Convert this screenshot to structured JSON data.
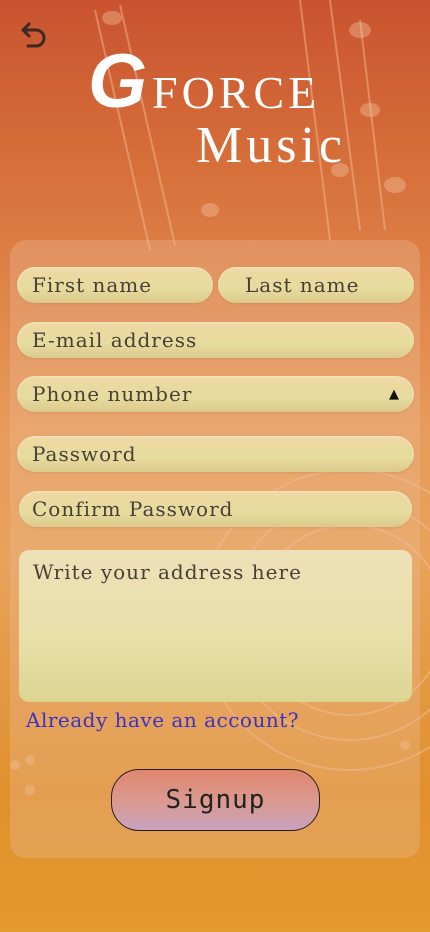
{
  "header": {
    "back_icon": "undo-arrow-icon",
    "logo_letter": "G",
    "logo_force": "FORCE",
    "logo_music": "Music"
  },
  "form": {
    "first_name_placeholder": "First name",
    "last_name_placeholder": "Last name",
    "email_placeholder": "E-mail address",
    "phone_placeholder": "Phone number",
    "phone_dropdown_icon": "caret-up-icon",
    "password_placeholder": "Password",
    "confirm_password_placeholder": "Confirm Password",
    "address_placeholder": "Write your address here",
    "login_link": "Already have an account?",
    "signup_label": "Signup"
  },
  "colors": {
    "bg_top": "#c9532f",
    "bg_bottom": "#e39a2e",
    "field_fill": "#e6dc9e",
    "link": "#3b33c8",
    "button_top": "#e0876e",
    "button_bottom": "#c9a2c0"
  }
}
